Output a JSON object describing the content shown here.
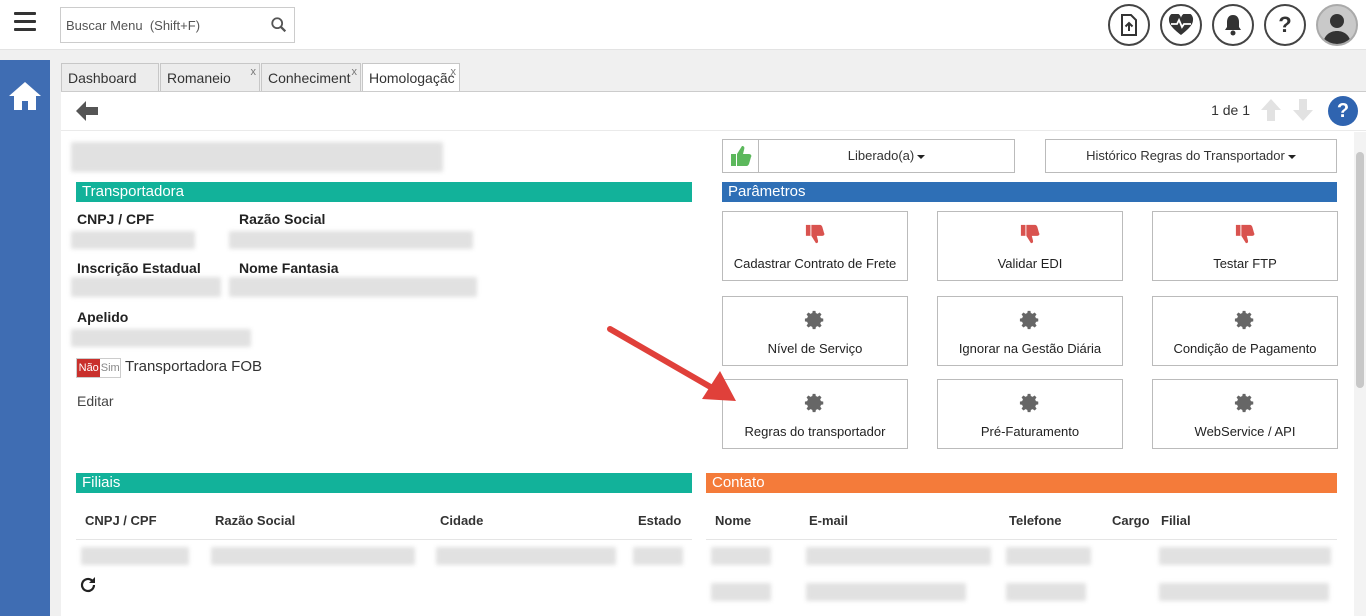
{
  "header": {
    "search_placeholder": "Buscar Menu  (Shift+F)",
    "icons": [
      "hamburger-menu-icon",
      "search-icon",
      "file-upload-icon",
      "heartbeat-icon",
      "bell-icon",
      "help-icon",
      "user-avatar-icon"
    ]
  },
  "tabs": [
    {
      "label": "Dashboard",
      "closable": false
    },
    {
      "label": "Romaneio",
      "closable": true
    },
    {
      "label": "Conheciment",
      "closable": true
    },
    {
      "label": "Homologaçãc",
      "closable": true,
      "active": true
    }
  ],
  "toolbar": {
    "pager": "1 de 1"
  },
  "transportadora": {
    "title": "Transportadora",
    "cnpj_label": "CNPJ / CPF",
    "razao_label": "Razão Social",
    "ie_label": "Inscrição Estadual",
    "fantasia_label": "Nome Fantasia",
    "apelido_label": "Apelido",
    "toggle_no": "Não",
    "toggle_yes": "Sim",
    "fob_label": "Transportadora FOB",
    "edit_label": "Editar"
  },
  "status": {
    "liberado": "Liberado(a)",
    "historico": "Histórico Regras do Transportador"
  },
  "parametros": {
    "title": "Parâmetros",
    "cards": [
      {
        "label": "Cadastrar Contrato de Frete",
        "icon": "thumbs-down-icon"
      },
      {
        "label": "Validar EDI",
        "icon": "thumbs-down-icon"
      },
      {
        "label": "Testar FTP",
        "icon": "thumbs-down-icon"
      },
      {
        "label": "Nível de Serviço",
        "icon": "gear-icon"
      },
      {
        "label": "Ignorar na Gestão Diária",
        "icon": "gear-icon"
      },
      {
        "label": "Condição de Pagamento",
        "icon": "gear-icon"
      },
      {
        "label": "Regras do transportador",
        "icon": "gear-icon"
      },
      {
        "label": "Pré-Faturamento",
        "icon": "gear-icon"
      },
      {
        "label": "WebService / API",
        "icon": "gear-icon"
      }
    ]
  },
  "filiais": {
    "title": "Filiais",
    "columns": [
      "CNPJ / CPF",
      "Razão Social",
      "Cidade",
      "Estado"
    ]
  },
  "contato": {
    "title": "Contato",
    "columns": [
      "Nome",
      "E-mail",
      "Telefone",
      "Cargo",
      "Filial"
    ]
  },
  "colors": {
    "teal": "#12b29a",
    "blue": "#2e6fb6",
    "orange": "#f47b3a",
    "rail": "#3f6db3",
    "thumbs_down": "#d9534f",
    "thumbs_up": "#5cb85c"
  }
}
